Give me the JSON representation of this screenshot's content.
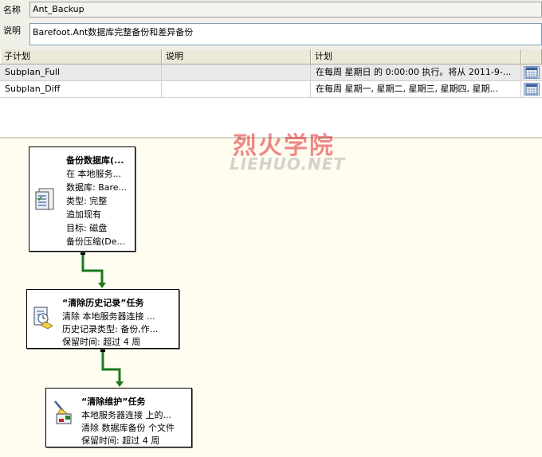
{
  "props": {
    "name_label": "名称",
    "name_value": "Ant_Backup",
    "desc_label": "说明",
    "desc_value": "Barefoot.Ant数据库完整备份和差异备份"
  },
  "grid": {
    "headers": [
      "子计划",
      "说明",
      "计划"
    ],
    "rows": [
      {
        "name": "Subplan_Full",
        "desc": "",
        "schedule": "在每周 星期日 的 0:00:00 执行。将从 2011-9-..."
      },
      {
        "name": "Subplan_Diff",
        "desc": "",
        "schedule": "在每周 星期一, 星期二, 星期三, 星期四, 星期..."
      }
    ]
  },
  "watermark": {
    "top": "烈火学院",
    "bottom": "LIEHUO.NET"
  },
  "tasks": {
    "backup": {
      "title": "备份数据库(...",
      "lines": [
        "在 本地服务...",
        "数据库: Bare...",
        "类型: 完整",
        "追加现有",
        "目标: 磁盘",
        "备份压缩(De..."
      ]
    },
    "history": {
      "title": "“清除历史记录”任务",
      "lines": [
        "清除 本地服务器连接 ...",
        "历史记录类型: 备份,作...",
        "保留时间: 超过 4 周"
      ]
    },
    "cleanup": {
      "title": "“清除维护”任务",
      "lines": [
        "本地服务器连接 上的...",
        "清除 数据库备份 个文件",
        "保留时间: 超过 4 周"
      ]
    }
  },
  "colors": {
    "connector": "#1a7a1a",
    "panel_bg": "#f0efe8",
    "canvas_bg": "#fffcf0"
  },
  "icons": {
    "schedule_button": "calendar-icon",
    "backup_task": "database-backup-icon",
    "history_task": "history-cleanup-icon",
    "cleanup_task": "maintenance-cleanup-icon"
  }
}
